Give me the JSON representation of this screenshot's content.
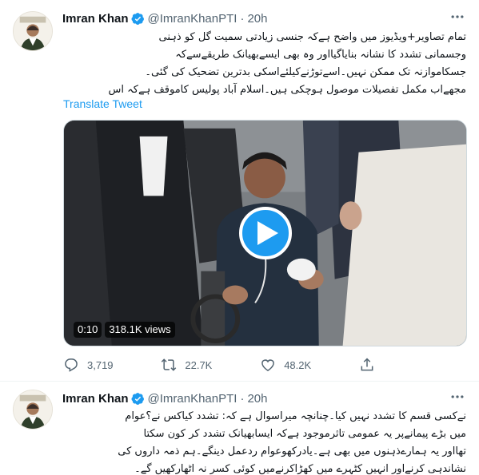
{
  "tweets": [
    {
      "author": {
        "name": "Imran Khan",
        "handle": "@ImranKhanPTI",
        "time": "20h",
        "separator": "·"
      },
      "body_lines": [
        "تمام تصاویر+ویڈیوز میں واضح ہےکہ جنسی زیادتی سمیت گل کو ذہنی",
        "وجسمانی تشدد کا نشانہ بنایاگیااور وہ بھی ایسےبھیانک طریقےسےکہ",
        "جسکاموازنہ تک ممکن نہیں۔اسےتوڑنےکیلئےاسکی بدترین تضحیک کی گئی۔",
        "مجھےاب مکمل تفصیلات موصول ہوچکی ہیں۔اسلام آباد پولیس کاموقف ہےکہ اس"
      ],
      "translate_label": "Translate Tweet",
      "media": {
        "duration": "0:10",
        "views": "318.1K views"
      },
      "actions": {
        "replies": "3,719",
        "retweets": "22.7K",
        "likes": "48.2K"
      }
    },
    {
      "author": {
        "name": "Imran Khan",
        "handle": "@ImranKhanPTI",
        "time": "20h",
        "separator": "·"
      },
      "body_lines": [
        "نےکسی قسم کا تشدد نہیں کیا۔چنانچہ میراسوال ہے کہ: تشدد کیاکس نے؟عوام",
        "میں بڑے پیمانےپر یہ عمومی تاثرموجود ہےکہ ایسابھیانک تشدد کر کون سکتا",
        "تھااور یہ ہمارےذہنوں میں بھی ہے۔یادرکھوعوام ردعمل دینگے۔ہم ذمہ داروں کی",
        "نشاندہی کرنےاور انہیں کٹہرے میں کھڑاکرنےمیں کوئی کسر نہ اٹھارکھیں گے۔"
      ]
    }
  ],
  "colors": {
    "verified": "#1d9bf0",
    "link": "#1d9bf0",
    "muted": "#536471",
    "text": "#0f1419"
  },
  "icons": [
    "verified-badge-icon",
    "more-icon",
    "play-icon",
    "reply-icon",
    "retweet-icon",
    "like-icon",
    "share-icon"
  ]
}
